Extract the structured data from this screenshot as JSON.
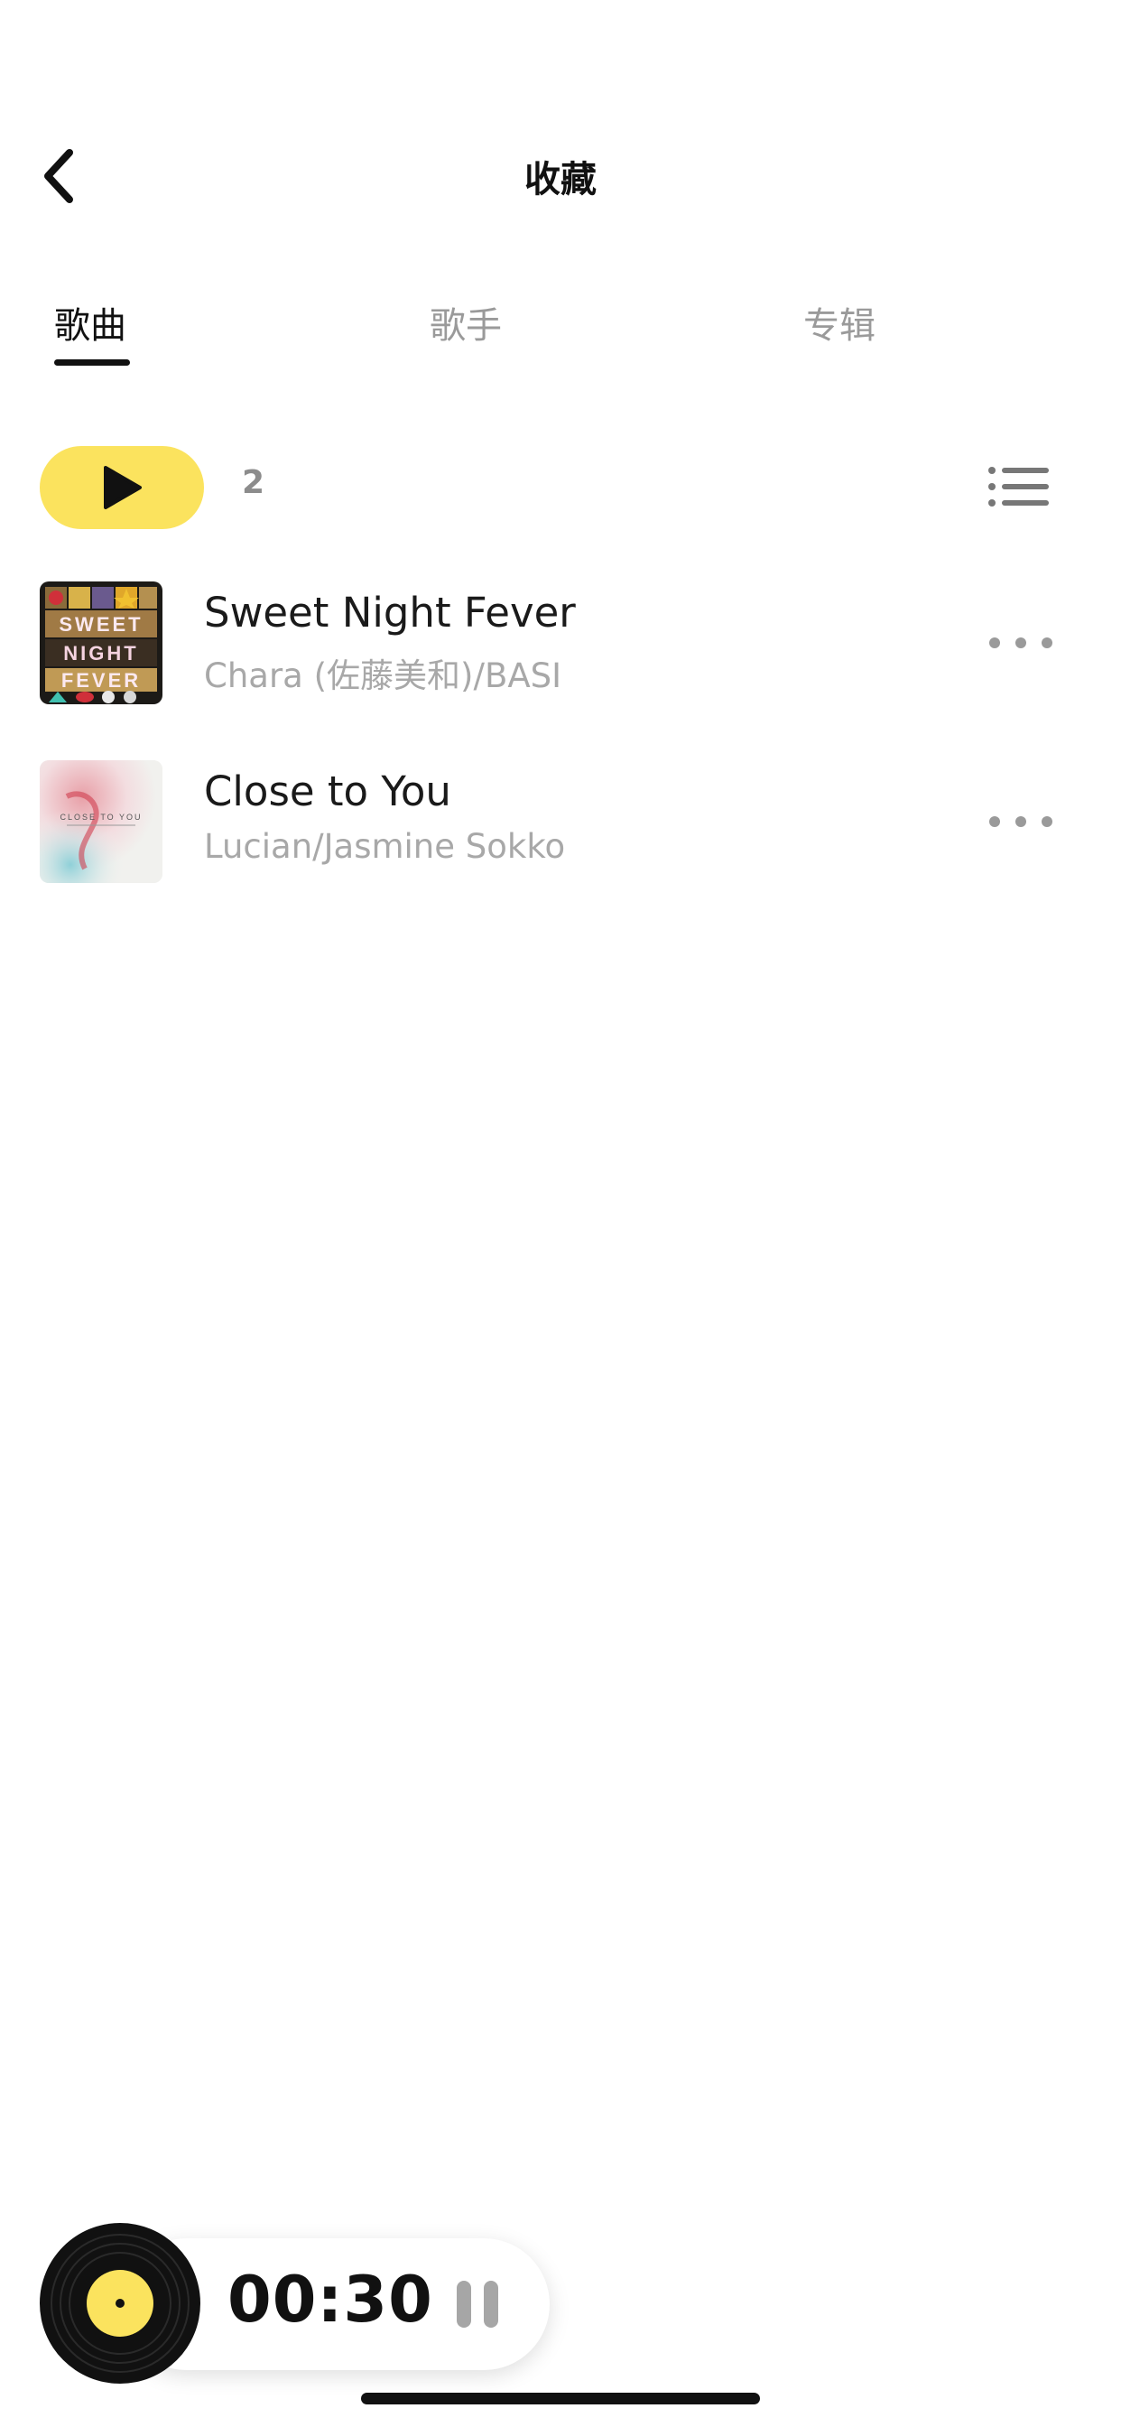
{
  "header": {
    "title": "收藏",
    "back_icon": "chevron-left-icon"
  },
  "tabs": [
    {
      "label": "歌曲",
      "active": true
    },
    {
      "label": "歌手",
      "active": false
    },
    {
      "label": "专辑",
      "active": false
    }
  ],
  "actions": {
    "play_all_icon": "play-icon",
    "song_count": "2",
    "list_icon": "list-icon",
    "accent_color": "#fbe35e"
  },
  "songs": [
    {
      "title": "Sweet Night Fever",
      "artist": "Chara (佐藤美和)/BASI",
      "cover_text": [
        "SWEET",
        "NIGHT",
        "FEVER"
      ],
      "more_icon": "more-icon"
    },
    {
      "title": "Close to You",
      "artist": "Lucian/Jasmine Sokko",
      "cover_text": "CLOSE TO YOU",
      "more_icon": "more-icon"
    }
  ],
  "player": {
    "time": "00:30",
    "record_icon": "vinyl-record-icon",
    "pause_icon": "pause-icon"
  }
}
